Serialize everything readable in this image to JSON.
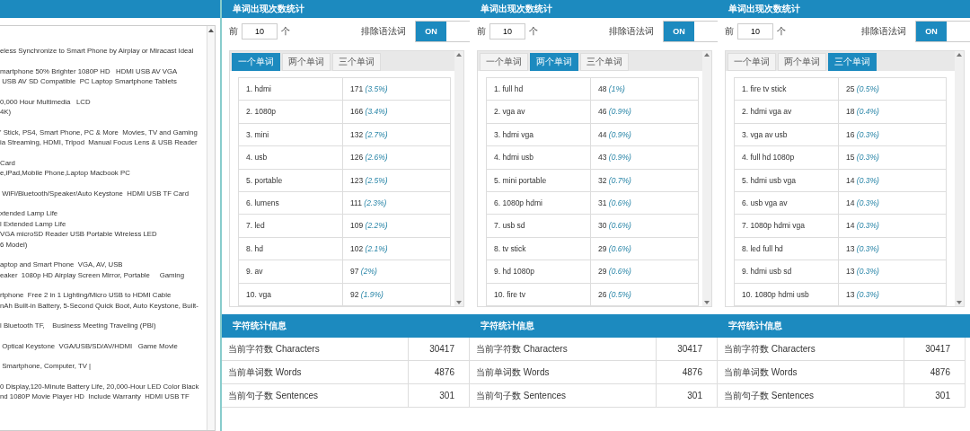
{
  "text_area": {
    "paragraphs": [
      [
        "eless Synchronize to Smart Phone by Airplay or Miracast Ideal"
      ],
      [
        "martphone 50% Brighter 1080P HD   HDMI USB AV VGA",
        " USB AV SD Compatible  PC Laptop Smartphone Tablets"
      ],
      [
        "0,000 Hour Multimedia   LCD",
        "4K)"
      ],
      [
        "' Stick, PS4, Smart Phone, PC & More  Movies, TV and Gaming",
        "ia Streaming, HDMI, Tripod  Manual Focus Lens & USB Reader"
      ],
      [
        "Card",
        "e,iPad,Mobile Phone,Laptop Macbook PC"
      ],
      [
        " WiFi/Bluetooth/Speaker/Auto Keystone  HDMI USB TF Card"
      ],
      [
        "xtended Lamp Life",
        "l Extended Lamp Life",
        "VGA microSD Reader USB Portable Wireless LED",
        "6 Model)"
      ],
      [
        "aptop and Smart Phone  VGA, AV, USB",
        "eaker  1080p HD Airplay Screen Mirror, Portable     Gaming"
      ],
      [
        "rtphone  Free 2 in 1 Lighting/Micro USB to HDMI Cable",
        "nAh Built-in Battery, 5-Second Quick Boot, Auto Keystone, Built-"
      ],
      [
        "l Bluetooth TF,    Business Meeting Traveling (PBI)"
      ],
      [
        " Optical Keystone  VGA/USB/SD/AV/HDMI   Game Movie"
      ],
      [
        " Smartphone, Computer, TV |"
      ],
      [
        "0 Display,120-Minute Battery Life, 20,000-Hour LED Color Black",
        "nd 1080P Movie Player HD  Include Warranty  HDMI USB TF"
      ]
    ]
  },
  "panels": [
    {
      "title": "单词出现次数统计",
      "top_label": "前",
      "top_value": "10",
      "unit": "个",
      "exclude_label": "排除语法词",
      "toggle": {
        "label": "ON",
        "on": true
      },
      "tabs": [
        {
          "label": "一个单词",
          "selected": true
        },
        {
          "label": "两个单词",
          "selected": false
        },
        {
          "label": "三个单词",
          "selected": false
        }
      ],
      "rows": [
        {
          "term": "1. hdmi",
          "count": "171",
          "percent": "(3.5%)"
        },
        {
          "term": "2. 1080p",
          "count": "166",
          "percent": "(3.4%)"
        },
        {
          "term": "3. mini",
          "count": "132",
          "percent": "(2.7%)"
        },
        {
          "term": "4. usb",
          "count": "126",
          "percent": "(2.6%)"
        },
        {
          "term": "5. portable",
          "count": "123",
          "percent": "(2.5%)"
        },
        {
          "term": "6. lumens",
          "count": "111",
          "percent": "(2.3%)"
        },
        {
          "term": "7. led",
          "count": "109",
          "percent": "(2.2%)"
        },
        {
          "term": "8. hd",
          "count": "102",
          "percent": "(2.1%)"
        },
        {
          "term": "9. av",
          "count": "97",
          "percent": "(2%)"
        },
        {
          "term": "10. vga",
          "count": "92",
          "percent": "(1.9%)"
        }
      ]
    },
    {
      "title": "单词出现次数统计",
      "top_label": "前",
      "top_value": "10",
      "unit": "个",
      "exclude_label": "排除语法词",
      "toggle": {
        "label": "ON",
        "on": true
      },
      "tabs": [
        {
          "label": "一个单词",
          "selected": false
        },
        {
          "label": "两个单词",
          "selected": true
        },
        {
          "label": "三个单词",
          "selected": false
        }
      ],
      "rows": [
        {
          "term": "1. full hd",
          "count": "48",
          "percent": "(1%)"
        },
        {
          "term": "2. vga av",
          "count": "46",
          "percent": "(0.9%)"
        },
        {
          "term": "3. hdmi vga",
          "count": "44",
          "percent": "(0.9%)"
        },
        {
          "term": "4. hdmi usb",
          "count": "43",
          "percent": "(0.9%)"
        },
        {
          "term": "5. mini portable",
          "count": "32",
          "percent": "(0.7%)"
        },
        {
          "term": "6. 1080p hdmi",
          "count": "31",
          "percent": "(0.6%)"
        },
        {
          "term": "7. usb sd",
          "count": "30",
          "percent": "(0.6%)"
        },
        {
          "term": "8. tv stick",
          "count": "29",
          "percent": "(0.6%)"
        },
        {
          "term": "9. hd 1080p",
          "count": "29",
          "percent": "(0.6%)"
        },
        {
          "term": "10. fire tv",
          "count": "26",
          "percent": "(0.5%)"
        }
      ]
    },
    {
      "title": "单词出现次数统计",
      "top_label": "前",
      "top_value": "10",
      "unit": "个",
      "exclude_label": "排除语法词",
      "toggle": {
        "label": "ON",
        "on": true
      },
      "tabs": [
        {
          "label": "一个单词",
          "selected": false
        },
        {
          "label": "两个单词",
          "selected": false
        },
        {
          "label": "三个单词",
          "selected": true
        }
      ],
      "rows": [
        {
          "term": "1. fire tv stick",
          "count": "25",
          "percent": "(0.5%)"
        },
        {
          "term": "2. hdmi vga av",
          "count": "18",
          "percent": "(0.4%)"
        },
        {
          "term": "3. vga av usb",
          "count": "16",
          "percent": "(0.3%)"
        },
        {
          "term": "4. full hd 1080p",
          "count": "15",
          "percent": "(0.3%)"
        },
        {
          "term": "5. hdmi usb vga",
          "count": "14",
          "percent": "(0.3%)"
        },
        {
          "term": "6. usb vga av",
          "count": "14",
          "percent": "(0.3%)"
        },
        {
          "term": "7. 1080p hdmi vga",
          "count": "14",
          "percent": "(0.3%)"
        },
        {
          "term": "8. led full hd",
          "count": "13",
          "percent": "(0.3%)"
        },
        {
          "term": "9. hdmi usb sd",
          "count": "13",
          "percent": "(0.3%)"
        },
        {
          "term": "10. 1080p hdmi usb",
          "count": "13",
          "percent": "(0.3%)"
        }
      ]
    }
  ],
  "stats": [
    {
      "title": "字符统计信息",
      "rows": [
        {
          "label": "当前字符数 Characters",
          "value": "30417"
        },
        {
          "label": "当前单词数 Words",
          "value": "4876"
        },
        {
          "label": "当前句子数 Sentences",
          "value": "301"
        }
      ]
    },
    {
      "title": "字符统计信息",
      "rows": [
        {
          "label": "当前字符数 Characters",
          "value": "30417"
        },
        {
          "label": "当前单词数 Words",
          "value": "4876"
        },
        {
          "label": "当前句子数 Sentences",
          "value": "301"
        }
      ]
    },
    {
      "title": "字符统计信息",
      "rows": [
        {
          "label": "当前字符数 Characters",
          "value": "30417"
        },
        {
          "label": "当前单词数 Words",
          "value": "4876"
        },
        {
          "label": "当前句子数 Sentences",
          "value": "301"
        }
      ]
    }
  ]
}
